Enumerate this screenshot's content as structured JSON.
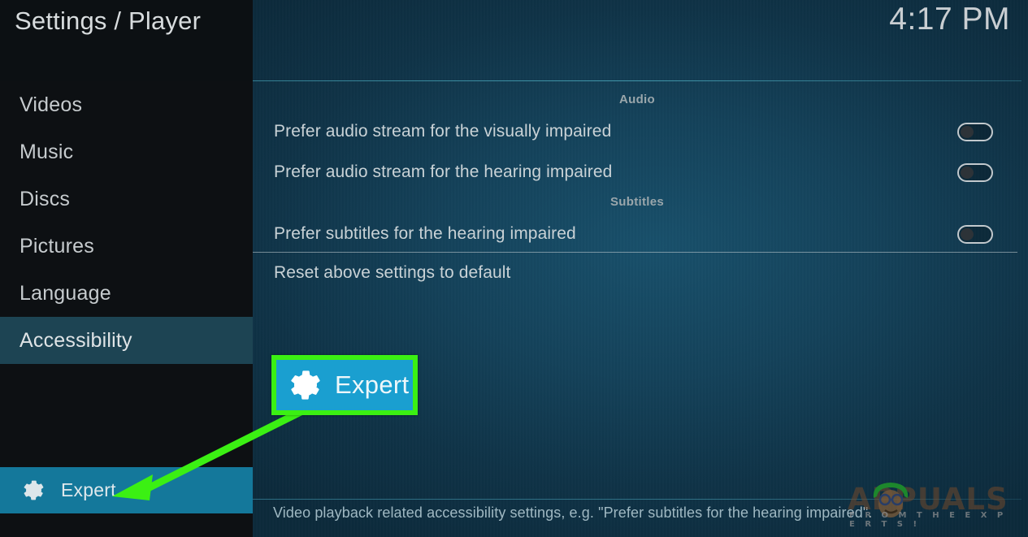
{
  "header": {
    "title": "Settings / Player",
    "clock": "4:17 PM"
  },
  "sidebar": {
    "items": [
      {
        "label": "Videos",
        "selected": false
      },
      {
        "label": "Music",
        "selected": false
      },
      {
        "label": "Discs",
        "selected": false
      },
      {
        "label": "Pictures",
        "selected": false
      },
      {
        "label": "Language",
        "selected": false
      },
      {
        "label": "Accessibility",
        "selected": true
      }
    ],
    "expert_button": {
      "label": "Expert",
      "icon": "gear-icon",
      "background_color": "#14789b"
    }
  },
  "main": {
    "sections": [
      {
        "header": "Audio",
        "rows": [
          {
            "label": "Prefer audio stream for the visually impaired",
            "control": "toggle",
            "value": "off"
          },
          {
            "label": "Prefer audio stream for the hearing impaired",
            "control": "toggle",
            "value": "off"
          }
        ]
      },
      {
        "header": "Subtitles",
        "rows": [
          {
            "label": "Prefer subtitles for the hearing impaired",
            "control": "toggle",
            "value": "off"
          },
          {
            "label": "Reset above settings to default",
            "control": "none",
            "value": ""
          }
        ]
      }
    ],
    "description": "Video playback related accessibility settings, e.g. \"Prefer subtitles for the hearing impaired\"."
  },
  "annotation": {
    "callout": {
      "label": "Expert",
      "icon": "gear-icon",
      "border_color": "#3bf013",
      "background_color": "#1a9fd0"
    },
    "arrow": {
      "color": "#3bf013",
      "points_to": "sidebar-expert-button"
    }
  },
  "watermark": {
    "brand": "APPUALS",
    "tagline": "F R O M   T H E   E X P E R T S !"
  },
  "colors": {
    "sidebar_bg": "#0d1013",
    "sidebar_selected": "#1d4453",
    "main_bg": "#123449",
    "accent_teal": "#14789b",
    "accent_blue": "#1a9fd0",
    "highlight_green": "#3bf013",
    "text_primary": "#c9d2d6",
    "text_muted": "#9aa6ab"
  }
}
